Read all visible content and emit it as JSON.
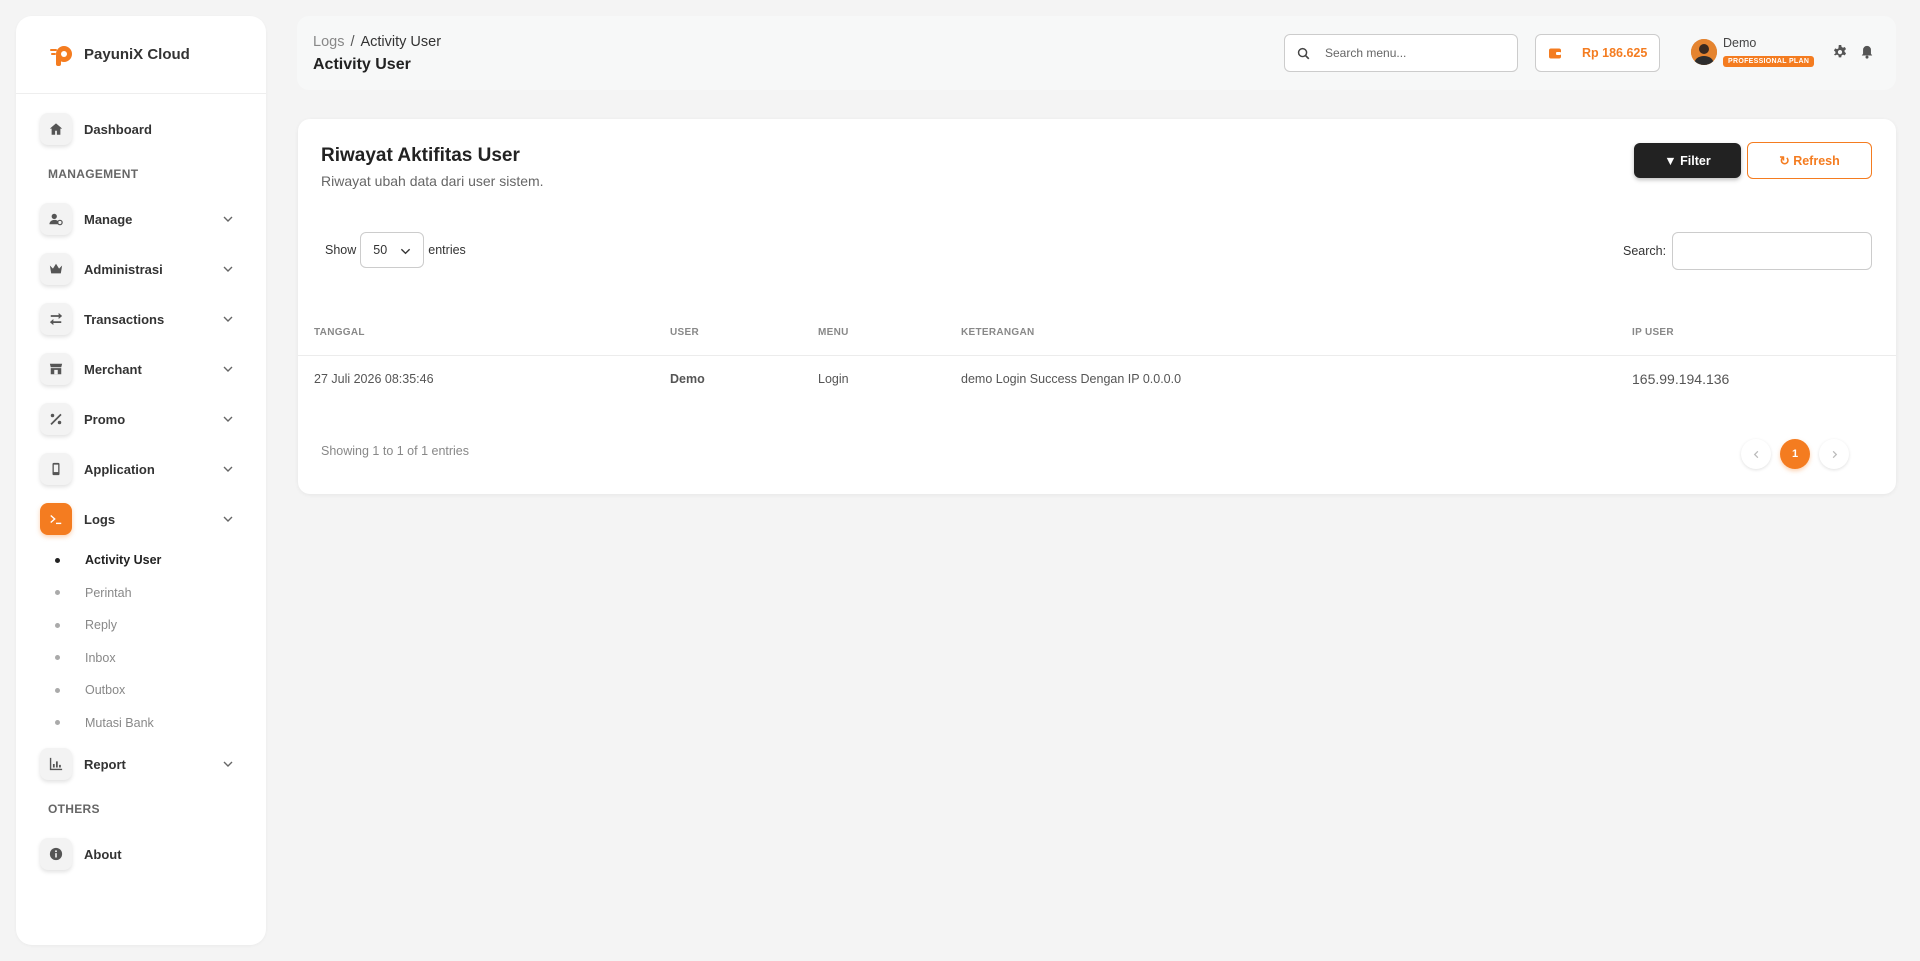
{
  "brand": {
    "name": "PayuniX Cloud"
  },
  "sidebar": {
    "dashboard": "Dashboard",
    "section_management": "MANAGEMENT",
    "items": [
      {
        "label": "Manage"
      },
      {
        "label": "Administrasi"
      },
      {
        "label": "Transactions"
      },
      {
        "label": "Merchant"
      },
      {
        "label": "Promo"
      },
      {
        "label": "Application"
      },
      {
        "label": "Logs"
      }
    ],
    "logs_sub": [
      {
        "label": "Activity User"
      },
      {
        "label": "Perintah"
      },
      {
        "label": "Reply"
      },
      {
        "label": "Inbox"
      },
      {
        "label": "Outbox"
      },
      {
        "label": "Mutasi Bank"
      }
    ],
    "report": "Report",
    "section_others": "OTHERS",
    "about": "About"
  },
  "header": {
    "breadcrumb_parent": "Logs",
    "breadcrumb_sep": "/",
    "breadcrumb_current": "Activity User",
    "title": "Activity User",
    "search_placeholder": "Search menu...",
    "balance": "Rp 186.625",
    "user_name": "Demo",
    "plan": "PROFESSIONAL PLAN"
  },
  "card": {
    "title": "Riwayat Aktifitas User",
    "subtitle": "Riwayat ubah data dari user sistem.",
    "filter_label": "Filter",
    "refresh_label": "Refresh",
    "show_label": "Show",
    "page_length": "50",
    "entries_label": "entries",
    "search_label": "Search:",
    "columns": [
      "TANGGAL",
      "USER",
      "MENU",
      "KETERANGAN",
      "IP USER"
    ],
    "rows": [
      {
        "tanggal": "27 Juli 2026 08:35:46",
        "user": "Demo",
        "menu": "Login",
        "keterangan": "demo Login Success Dengan IP 0.0.0.0",
        "ip": "165.99.194.136"
      }
    ],
    "showing": "Showing 1 to 1 of 1 entries",
    "page_current": "1"
  },
  "colors": {
    "accent": "#f47c20",
    "dark": "#222222"
  }
}
